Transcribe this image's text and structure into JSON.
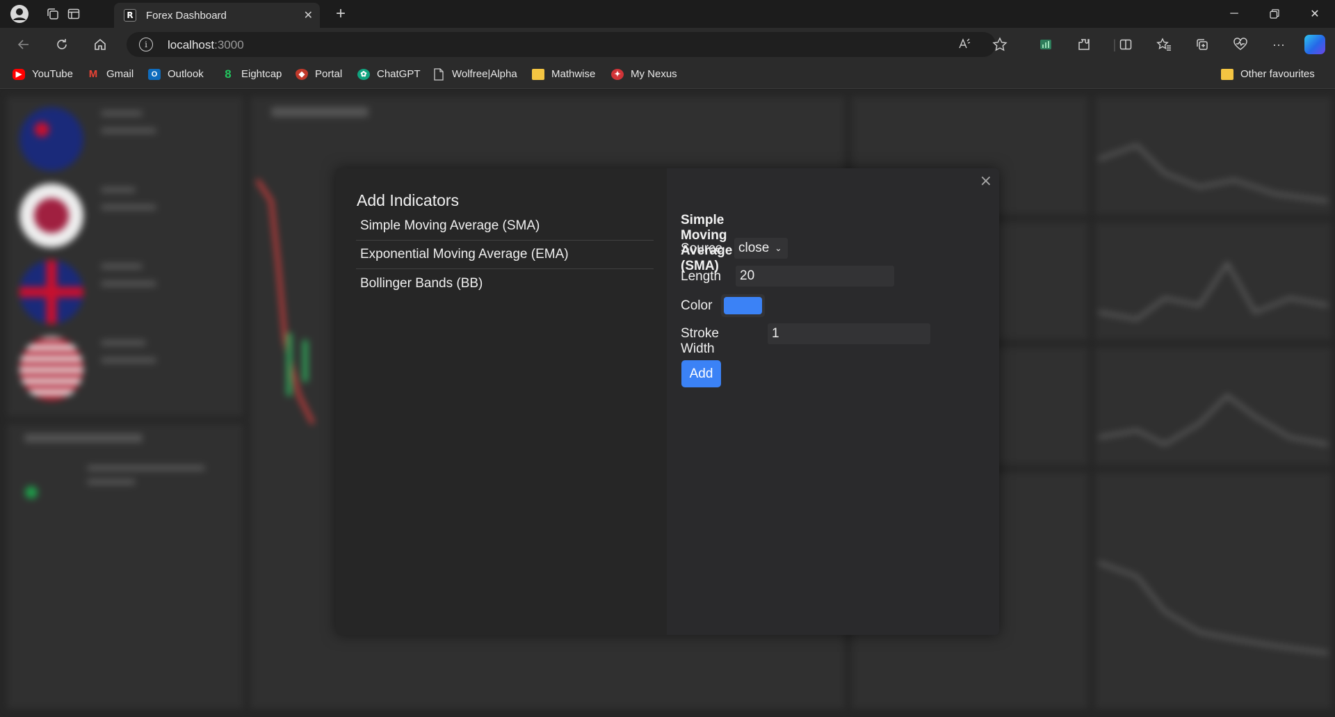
{
  "browser": {
    "tab": {
      "title": "Forex Dashboard",
      "favicon": "R"
    },
    "url": {
      "host": "localhost",
      "port": ":3000"
    },
    "bookmarks": [
      {
        "label": "YouTube",
        "icon": "youtube-icon",
        "color": "#ff0000"
      },
      {
        "label": "Gmail",
        "icon": "gmail-icon",
        "color": "#ea4335"
      },
      {
        "label": "Outlook",
        "icon": "outlook-icon",
        "color": "#0f6cbd"
      },
      {
        "label": "Eightcap",
        "icon": "eightcap-icon",
        "color": "#22c55e"
      },
      {
        "label": "Portal",
        "icon": "portal-icon",
        "color": "#c0392b"
      },
      {
        "label": "ChatGPT",
        "icon": "chatgpt-icon",
        "color": "#10a37f"
      },
      {
        "label": "Wolfree|Alpha",
        "icon": "page-icon",
        "color": "#cccccc"
      },
      {
        "label": "Mathwise",
        "icon": "folder-icon",
        "color": "#f4c542"
      },
      {
        "label": "My Nexus",
        "icon": "nexus-icon",
        "color": "#d13438"
      }
    ],
    "other_favourites": "Other favourites"
  },
  "modal": {
    "title": "Add Indicators",
    "indicators": [
      "Simple Moving Average (SMA)",
      "Exponential Moving Average (EMA)",
      "Bollinger Bands (BB)"
    ],
    "form": {
      "title": "Simple Moving Average (SMA)",
      "source_label": "Source",
      "source_value": "close",
      "length_label": "Length",
      "length_value": "20",
      "color_label": "Color",
      "color_value": "#3b82f6",
      "stroke_label": "Stroke Width",
      "stroke_value": "1",
      "add_label": "Add"
    },
    "close_symbol": "×"
  }
}
